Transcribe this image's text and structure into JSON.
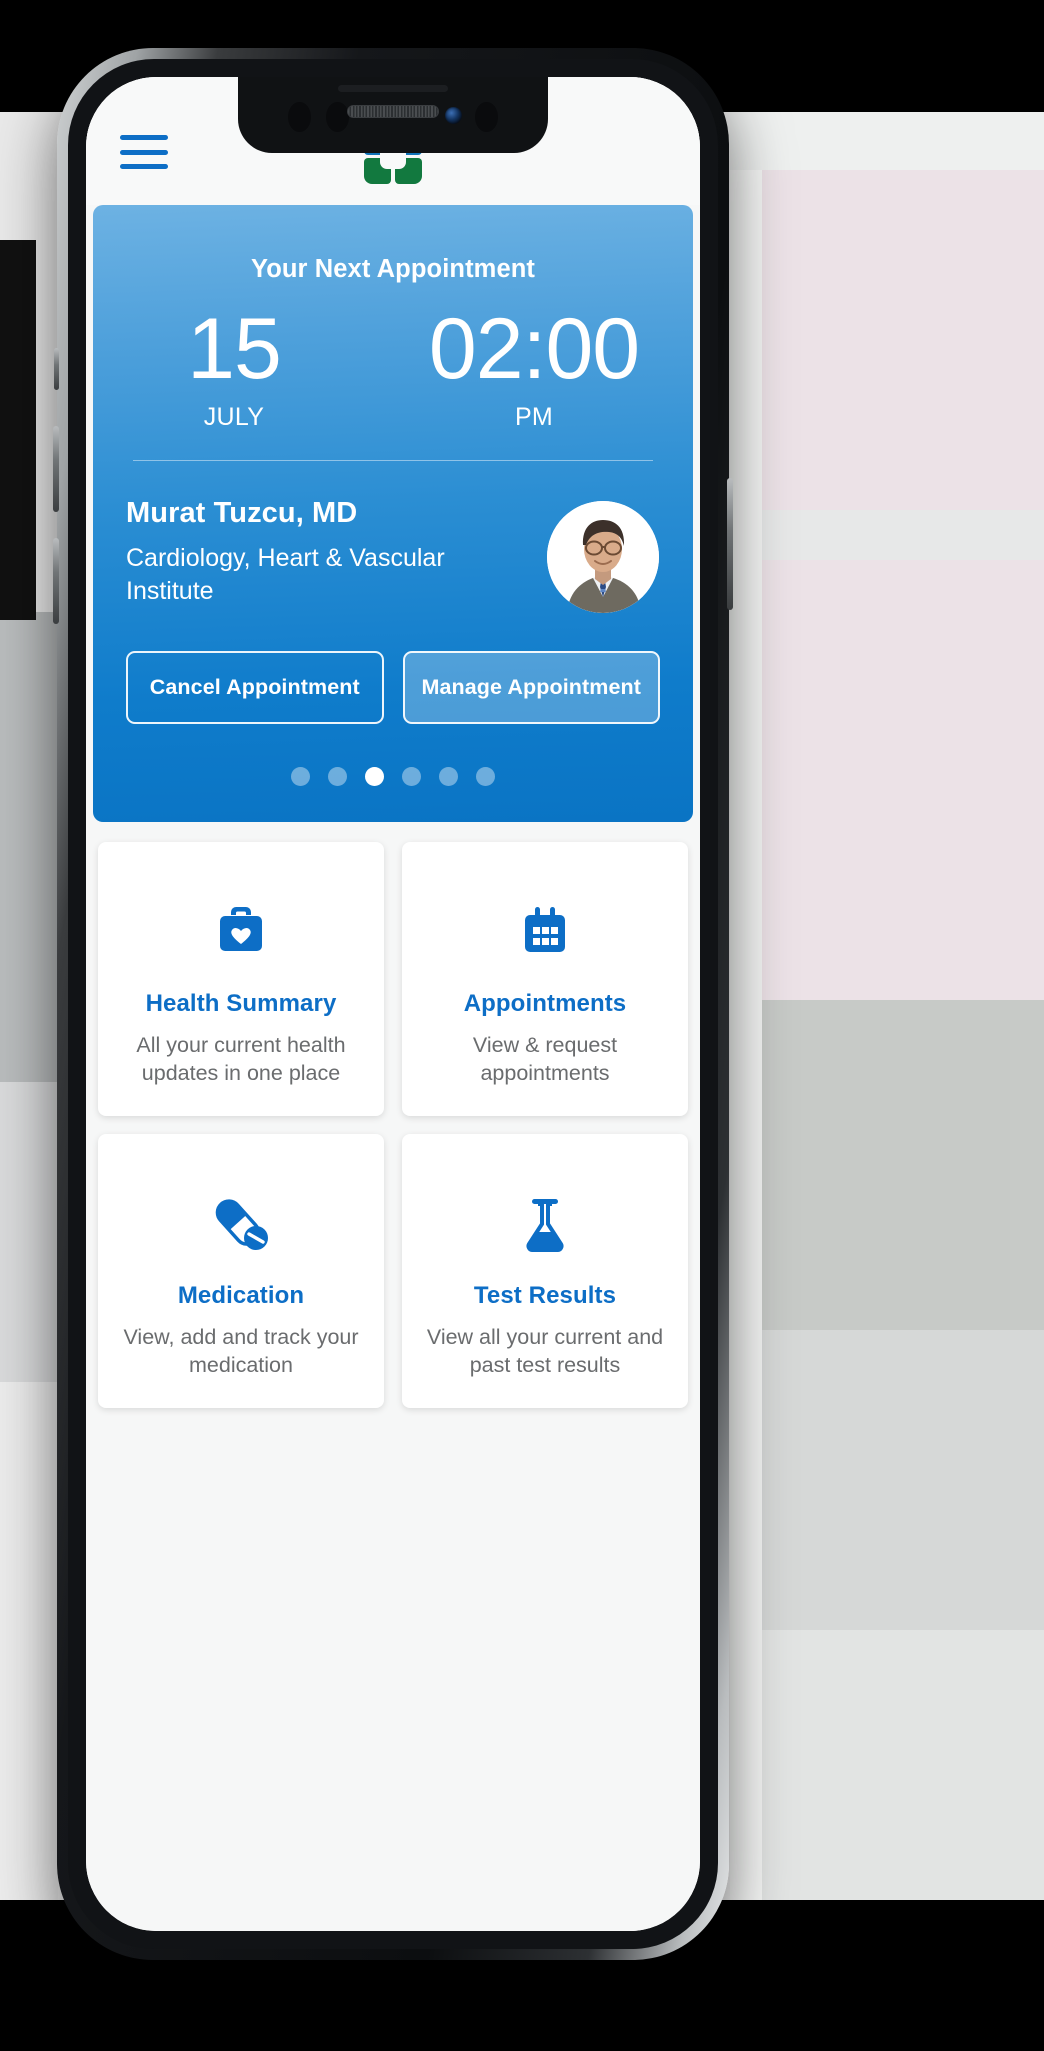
{
  "app": {
    "brand_logo": "cleveland-clinic-logo",
    "menu_icon": "hamburger-menu-icon",
    "accent_blue": "#0d6ec6",
    "logo_blue": "#1073b8",
    "logo_green": "#12793f"
  },
  "hero": {
    "title": "Your Next Appointment",
    "day_number": "15",
    "month": "JULY",
    "time": "02:00",
    "meridiem": "PM",
    "doctor_name": "Murat Tuzcu, MD",
    "doctor_specialty": "Cardiology, Heart & Vascular Institute",
    "doctor_avatar": "doctor-headshot",
    "cancel_label": "Cancel Appointment",
    "manage_label": "Manage Appointment",
    "pager": {
      "total": 6,
      "active_index": 2
    }
  },
  "tiles": [
    {
      "icon": "medical-bag-heart-icon",
      "title": "Health Summary",
      "desc": "All your current health updates in one place"
    },
    {
      "icon": "calendar-icon",
      "title": "Appointments",
      "desc": "View & request appointments"
    },
    {
      "icon": "pill-capsule-icon",
      "title": "Medication",
      "desc": "View, add and track your medication"
    },
    {
      "icon": "lab-flask-icon",
      "title": "Test Results",
      "desc": "View all your current and past test results"
    }
  ]
}
